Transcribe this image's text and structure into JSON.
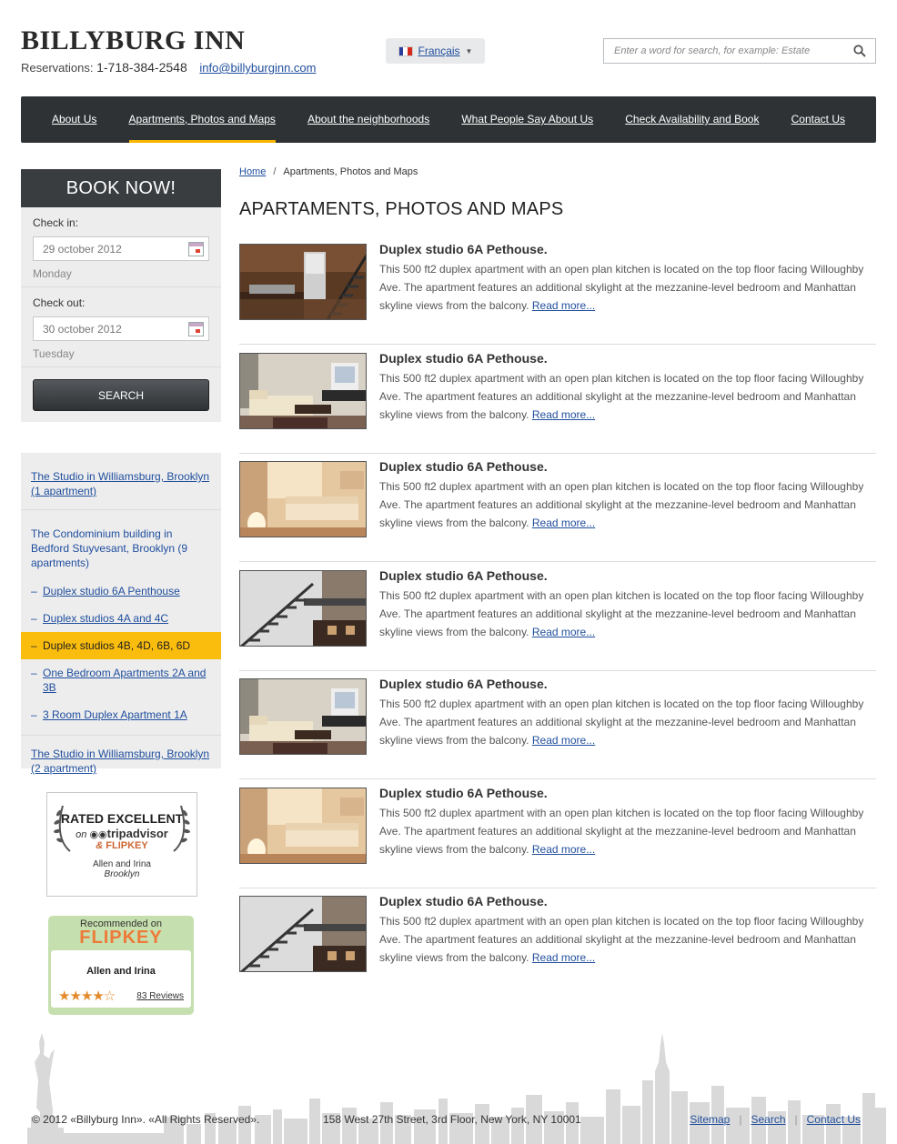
{
  "header": {
    "logo": "BILLYBURG INN",
    "reservations_label": "Reservations:",
    "phone": "1-718-384-2548",
    "email": "info@billyburginn.com",
    "language": "Français",
    "search_placeholder": "Enter a word for search, for example: Estate"
  },
  "nav": [
    {
      "label": "About Us",
      "active": false
    },
    {
      "label": "Apartments, Photos and Maps",
      "active": true
    },
    {
      "label": "About the neighborhoods",
      "active": false
    },
    {
      "label": "What People Say About Us",
      "active": false
    },
    {
      "label": "Check Availability and Book",
      "active": false
    },
    {
      "label": "Contact Us",
      "active": false
    }
  ],
  "book": {
    "title": "BOOK NOW!",
    "checkin_label": "Check in:",
    "checkin_date": "29 october 2012",
    "checkin_day": "Monday",
    "checkout_label": "Check out:",
    "checkout_date": "30 october 2012",
    "checkout_day": "Tuesday",
    "search_label": "SEARCH"
  },
  "side_menu": {
    "item1": "The Studio in Williamsburg, Brooklyn (1 apartment)",
    "item2": "The Condominium building in Bedford Stuyvesant, Brooklyn (9 apartments)",
    "subitems": [
      "Duplex studio 6A Penthouse",
      "Duplex studios 4A and 4C",
      "Duplex studios 4B, 4D, 6B, 6D",
      "One Bedroom Apartments 2A and 3B",
      "3 Room Duplex Apartment 1A"
    ],
    "item3": "The Studio in Williamsburg, Brooklyn (2 apartment)"
  },
  "tripadvisor": {
    "rated": "RATED EXCELLENT",
    "on": "on",
    "brand": "tripadvisor",
    "amp": "&",
    "flipkey": "FLIPKEY",
    "names": "Allen and Irina",
    "place": "Brooklyn"
  },
  "flipkey_badge": {
    "recommended": "Recommended on",
    "brand": "FLIPKEY",
    "names": "Allen and Irina",
    "stars": "★★★★☆",
    "rating_stars": 4.5,
    "reviews": "83 Reviews"
  },
  "breadcrumb": {
    "home": "Home",
    "sep": "/",
    "current": "Apartments, Photos and Maps"
  },
  "page_title": "APARTAMENTS, PHOTOS AND MAPS",
  "listings": [
    {
      "title": "Duplex studio 6A Pethouse.",
      "desc": "This 500 ft2 duplex apartment with an open plan kitchen is located on the top floor facing Willoughby Ave. The apartment features an additional skylight at the mezzanine-level bedroom and Manhattan skyline views from the balcony.",
      "more": "Read more...",
      "photo": "kitchen-stairs"
    },
    {
      "title": "Duplex studio 6A Pethouse.",
      "desc": "This 500 ft2 duplex apartment with an open plan kitchen is located on the top floor facing Willoughby Ave. The apartment features an additional skylight at the mezzanine-level bedroom and Manhattan skyline views from the balcony.",
      "more": "Read more...",
      "photo": "living-tv"
    },
    {
      "title": "Duplex studio 6A Pethouse.",
      "desc": "This 500 ft2 duplex apartment with an open plan kitchen is located on the top floor facing Willoughby Ave. The apartment features an additional skylight at the mezzanine-level bedroom and Manhattan skyline views from the balcony.",
      "more": "Read more...",
      "photo": "living-warm"
    },
    {
      "title": "Duplex studio 6A Pethouse.",
      "desc": "This 500 ft2 duplex apartment with an open plan kitchen is located on the top floor facing Willoughby Ave. The apartment features an additional skylight at the mezzanine-level bedroom and Manhattan skyline views from the balcony.",
      "more": "Read more...",
      "photo": "stairs-loft"
    },
    {
      "title": "Duplex studio 6A Pethouse.",
      "desc": "This 500 ft2 duplex apartment with an open plan kitchen is located on the top floor facing Willoughby Ave. The apartment features an additional skylight at the mezzanine-level bedroom and Manhattan skyline views from the balcony.",
      "more": "Read more...",
      "photo": "living-tv"
    },
    {
      "title": "Duplex studio 6A Pethouse.",
      "desc": "This 500 ft2 duplex apartment with an open plan kitchen is located on the top floor facing Willoughby Ave. The apartment features an additional skylight at the mezzanine-level bedroom and Manhattan skyline views from the balcony.",
      "more": "Read more...",
      "photo": "living-warm"
    },
    {
      "title": "Duplex studio 6A Pethouse.",
      "desc": "This 500 ft2 duplex apartment with an open plan kitchen is located on the top floor facing Willoughby Ave. The apartment features an additional skylight at the mezzanine-level bedroom and Manhattan skyline views from the balcony.",
      "more": "Read more...",
      "photo": "stairs-loft"
    }
  ],
  "footer": {
    "copyright": "© 2012 «Billyburg Inn». «All Rights Reserved».",
    "address": "158 West 27th Street, 3rd Floor, New York, NY 10001",
    "sitemap": "Sitemap",
    "search": "Search",
    "contact": "Contact Us",
    "sep": "|"
  },
  "colors": {
    "nav_bg": "#2f3234",
    "accent": "#f7b500",
    "link": "#1f4e9c",
    "panel": "#ededee"
  }
}
